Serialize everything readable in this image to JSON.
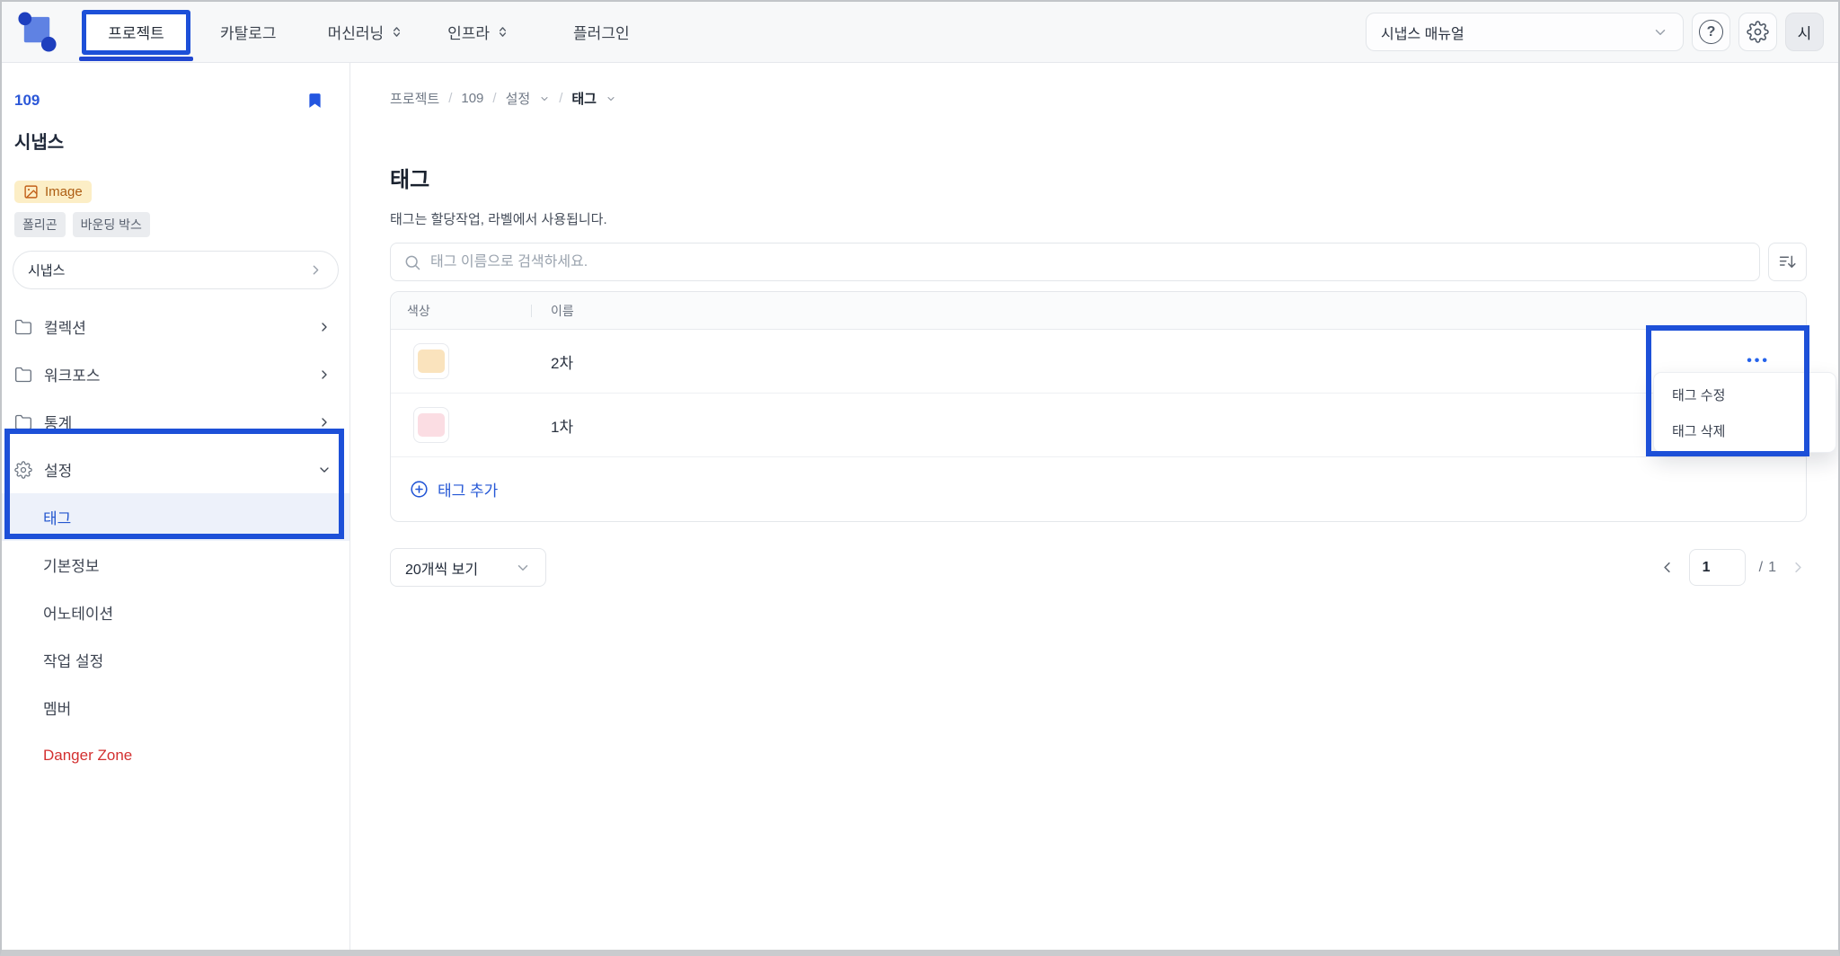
{
  "topbar": {
    "tabs": [
      {
        "label": "프로젝트"
      },
      {
        "label": "카탈로그"
      },
      {
        "label": "머신러닝"
      },
      {
        "label": "인프라"
      },
      {
        "label": "플러그인"
      }
    ],
    "manual_label": "시냅스 매뉴얼",
    "avatar_initial": "시",
    "help_glyph": "?"
  },
  "sidebar": {
    "project_id": "109",
    "project_name": "시냅스",
    "type_badge": "Image",
    "tag_badges": [
      {
        "label": "폴리곤"
      },
      {
        "label": "바운딩 박스"
      }
    ],
    "selector_value": "시냅스",
    "menu": [
      {
        "label": "컬렉션"
      },
      {
        "label": "워크포스"
      },
      {
        "label": "통계"
      },
      {
        "label": "설정"
      }
    ],
    "settings_children": [
      {
        "label": "태그"
      },
      {
        "label": "기본정보"
      },
      {
        "label": "어노테이션"
      },
      {
        "label": "작업 설정"
      },
      {
        "label": "멤버"
      },
      {
        "label": "Danger Zone"
      }
    ]
  },
  "breadcrumb": {
    "separator": "/",
    "items": [
      {
        "label": "프로젝트"
      },
      {
        "label": "109"
      },
      {
        "label": "설정"
      },
      {
        "label": "태그"
      }
    ]
  },
  "main": {
    "title": "태그",
    "description": "태그는 할당작업, 라벨에서 사용됩니다.",
    "search": {
      "placeholder": "태그 이름으로 검색하세요."
    },
    "table": {
      "columns": [
        {
          "label": "색상"
        },
        {
          "label": "이름"
        }
      ],
      "rows": [
        {
          "color": "#FAE3BD",
          "name": "2차"
        },
        {
          "color": "#FBDDE3",
          "name": "1차"
        }
      ],
      "add_button": "태그 추가"
    },
    "page_size": "20개씩 보기",
    "pagination": {
      "current": "1",
      "separator": "/",
      "total": "1"
    }
  },
  "context_menu": {
    "trigger": "•••",
    "items": [
      {
        "label": "태그 수정"
      },
      {
        "label": "태그 삭제"
      }
    ]
  },
  "colors": {
    "accent": "#2563EB",
    "annotation": "#1D50D8",
    "danger": "#D33030",
    "swatch_row1": "#FAE3BD",
    "swatch_row2": "#FBDDE3"
  }
}
